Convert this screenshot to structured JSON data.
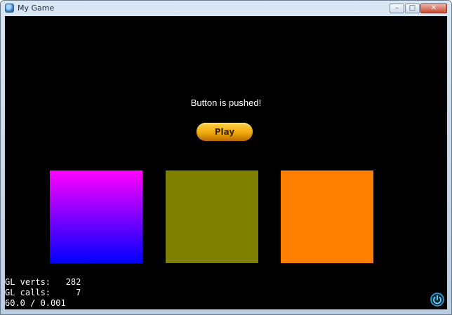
{
  "window": {
    "title": "My Game"
  },
  "controls": {
    "minimize": "–",
    "maximize": "□",
    "close": "✕"
  },
  "game": {
    "status_text": "Button is pushed!",
    "play_button_label": "Play",
    "squares": [
      {
        "color_top": "#ff00ff",
        "color_bottom": "#0000ff"
      },
      {
        "color": "#808000"
      },
      {
        "color": "#ff8000"
      }
    ]
  },
  "stats": {
    "verts": "GL verts:   282",
    "calls": "GL calls:     7",
    "fps": "60.0 / 0.001"
  },
  "icons": {
    "app": "app-icon",
    "power": "power-icon"
  }
}
